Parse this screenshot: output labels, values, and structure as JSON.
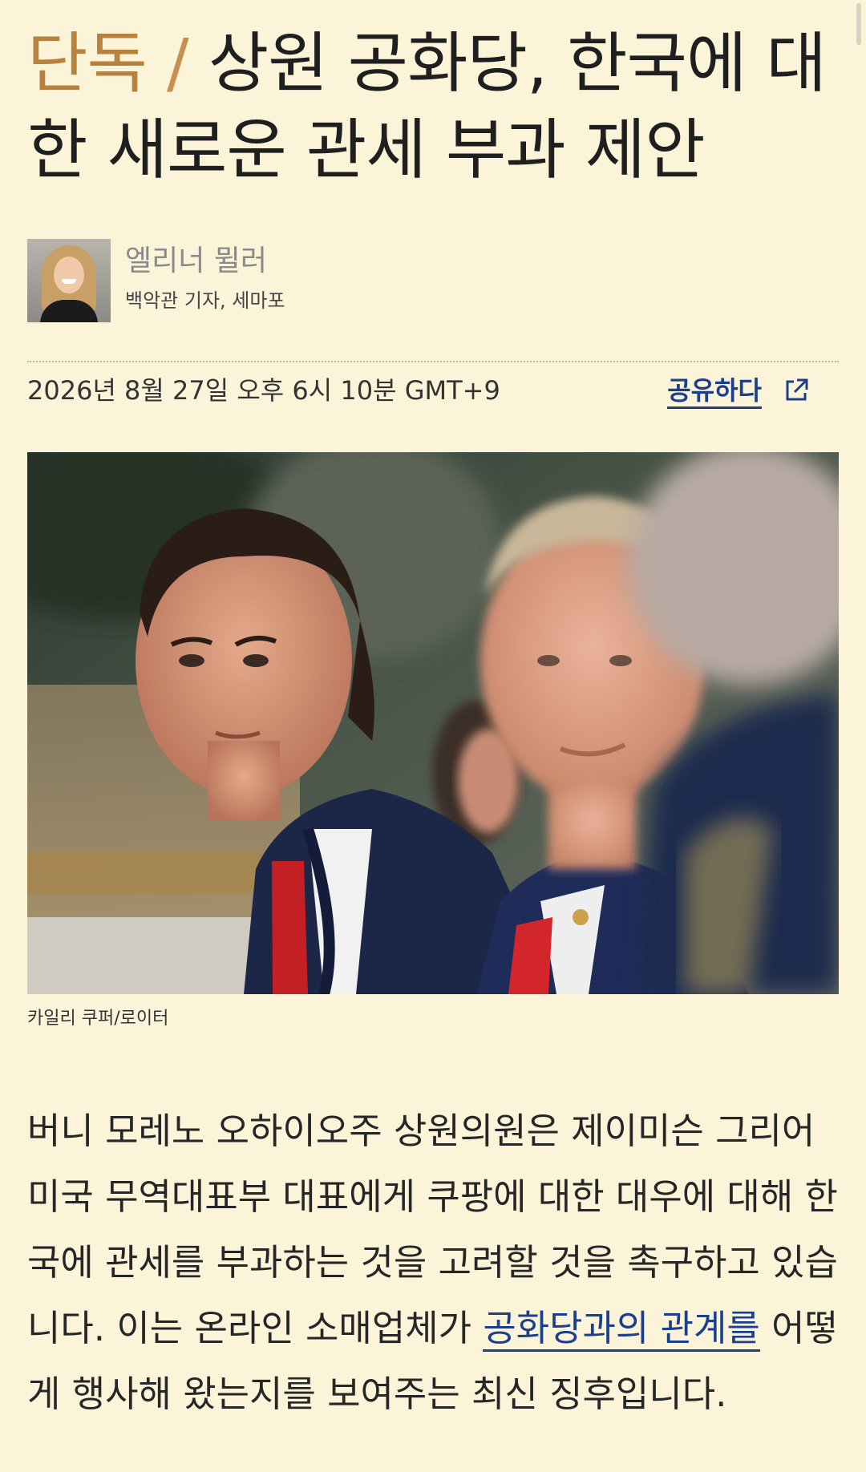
{
  "article": {
    "kicker": "단독",
    "slash": "/",
    "title": "상원 공화당, 한국에 대한 새로운 관세 부과 제안"
  },
  "author": {
    "name": "엘리너 뮐러",
    "role": "백악관 기자, 세마포"
  },
  "meta": {
    "datetime": "2026년 8월 27일 오후 6시 10분 GMT+9",
    "share_label": "공유하다",
    "share_icon": "external-link-icon"
  },
  "photo": {
    "caption": "카일리 쿠퍼/로이터"
  },
  "body": {
    "text_before_link": "버니 모레노 오하이오주 상원의원은 제이미슨 그리어 미국 무역대표부 대표에게 쿠팡에 대한 대우에 대해 한국에 관세를 부과하는 것을 고려할 것을 촉구하고 있습니다. 이는 온라인 소매업체가 ",
    "link_text": "공화당과의 관계를",
    "text_after_link": " 어떻게 행사해 왔는지를 보여주는 최신 징후입니다."
  },
  "colors": {
    "background": "#fbf4d9",
    "kicker": "#b7813e",
    "link": "#1c3f8c"
  }
}
